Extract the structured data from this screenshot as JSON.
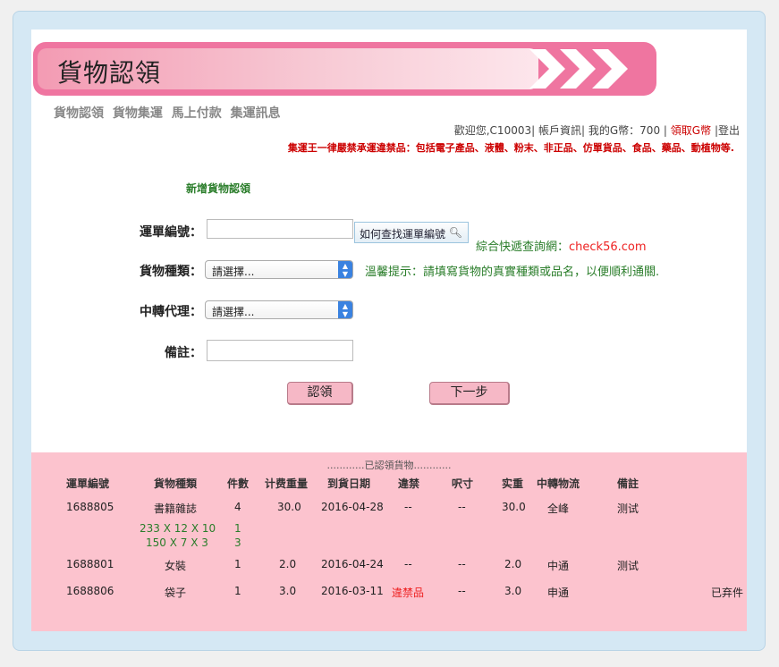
{
  "header": {
    "title": "貨物認領"
  },
  "nav": [
    "貨物認領",
    "貨物集運",
    "馬上付款",
    "集運訊息"
  ],
  "welcome": {
    "greeting": "歡迎您,C10003",
    "sep1": "|",
    "account": "帳戶資訊",
    "sep2": "|",
    "gcoin": "我的G幣：700",
    "sep3": "|",
    "claim": "領取G幣",
    "sep4": "|",
    "logout": "登出"
  },
  "notice": "集運王一律嚴禁承運違禁品：包括電子產品、液體、粉末、非正品、仿單貨品、食品、藥品、動植物等.",
  "form": {
    "section_title": "新增貨物認領",
    "waybill_label": "運單編號：",
    "waybill_value": "",
    "find_button": "如何查找運單編號",
    "express_hint_prefix": "綜合快遞查詢網：",
    "express_hint_link": "check56.com",
    "category_label": "貨物種類：",
    "category_value": "請選擇...",
    "category_hint": "溫馨提示：請填寫貨物的真實種類或品名，以便順利通關.",
    "agent_label": "中轉代理：",
    "agent_value": "請選擇...",
    "remark_label": "備註：",
    "remark_value": "",
    "submit_button": "認領",
    "next_button": "下一步"
  },
  "claimed": {
    "title": "............已認領貨物............",
    "headers": [
      "運單編號",
      "貨物種類",
      "件數",
      "计费重量",
      "到貨日期",
      "違禁",
      "呎寸",
      "实重",
      "中轉物流",
      "備註"
    ],
    "rows": [
      {
        "waybill": "1688805",
        "category": "書籍雜誌",
        "qty": "4",
        "weight": "30.0",
        "date": "2016-04-28",
        "banned": "--",
        "size": "--",
        "actual": "30.0",
        "logistics": "全峰",
        "remark": "测试",
        "status": "",
        "dims": [
          {
            "size": "233 X 12 X 10",
            "qty": "1"
          },
          {
            "size": "150 X 7 X 3",
            "qty": "3"
          }
        ]
      },
      {
        "waybill": "1688801",
        "category": "女裝",
        "qty": "1",
        "weight": "2.0",
        "date": "2016-04-24",
        "banned": "--",
        "size": "--",
        "actual": "2.0",
        "logistics": "中通",
        "remark": "测试",
        "status": ""
      },
      {
        "waybill": "1688806",
        "category": "袋子",
        "qty": "1",
        "weight": "3.0",
        "date": "2016-03-11",
        "banned": "違禁品",
        "size": "--",
        "actual": "3.0",
        "logistics": "申通",
        "remark": "",
        "status": "已弃件"
      }
    ]
  }
}
